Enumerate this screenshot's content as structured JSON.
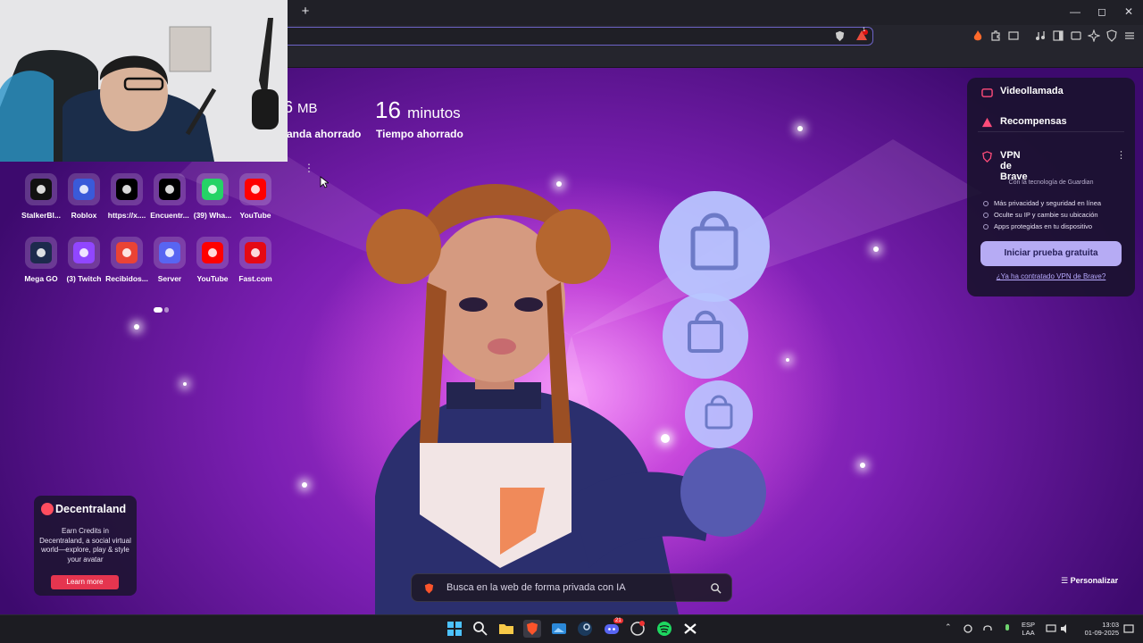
{
  "browser": {
    "new_tab_symbol": "+",
    "window_controls": {
      "minimize": "—",
      "maximize": "◻",
      "close": "✕"
    },
    "rewards_badge": "1"
  },
  "stats": {
    "bandwidth_value": "6",
    "bandwidth_unit": "MB",
    "bandwidth_label": "anda ahorrado",
    "time_value": "16",
    "time_unit": "minutos",
    "time_label": "Tiempo ahorrado"
  },
  "top_sites": [
    {
      "label": "StalkerBl...",
      "color": "#111111",
      "icon": "kick-icon"
    },
    {
      "label": "Roblox",
      "color": "#3a5ad9",
      "icon": "roblox-icon"
    },
    {
      "label": "https://x....",
      "color": "#000000",
      "icon": "x-icon"
    },
    {
      "label": "Encuentr...",
      "color": "#000000",
      "icon": "tiktok-icon"
    },
    {
      "label": "(39) Wha...",
      "color": "#25d366",
      "icon": "whatsapp-icon"
    },
    {
      "label": "YouTube",
      "color": "#ff0000",
      "icon": "youtube-icon"
    },
    {
      "label": "Mega GO",
      "color": "#1d2a4d",
      "icon": "mega-icon"
    },
    {
      "label": "(3) Twitch",
      "color": "#9146ff",
      "icon": "twitch-icon"
    },
    {
      "label": "Recibidos...",
      "color": "#ea4335",
      "icon": "gmail-icon"
    },
    {
      "label": "Server",
      "color": "#5865f2",
      "icon": "server-icon"
    },
    {
      "label": "YouTube",
      "color": "#ff0000",
      "icon": "youtube-icon"
    },
    {
      "label": "Fast.com",
      "color": "#e50914",
      "icon": "fast-icon"
    }
  ],
  "panel": {
    "video_call": "Videollamada",
    "rewards": "Recompensas",
    "vpn_title": "VPN de Brave",
    "vpn_tech": "Con la tecnología de  Guardian",
    "features": [
      "Más privacidad y seguridad en línea",
      "Oculte su IP y cambie su ubicación",
      "Apps protegidas en tu dispositivo"
    ],
    "cta": "Iniciar prueba gratuita",
    "link": "¿Ya ha contratado VPN de Brave?"
  },
  "ad": {
    "brand": "Decentraland",
    "body": "Earn Credits in Decentraland, a social virtual world—explore, play & style your avatar",
    "cta": "Learn more"
  },
  "search": {
    "placeholder": "Busca en la web de forma privada con IA"
  },
  "customize_label": "Personalizar",
  "tray": {
    "lang_line1": "ESP",
    "lang_line2": "LAA",
    "time": "13:03",
    "date": "01-09-2025",
    "discord_badge": "21"
  }
}
